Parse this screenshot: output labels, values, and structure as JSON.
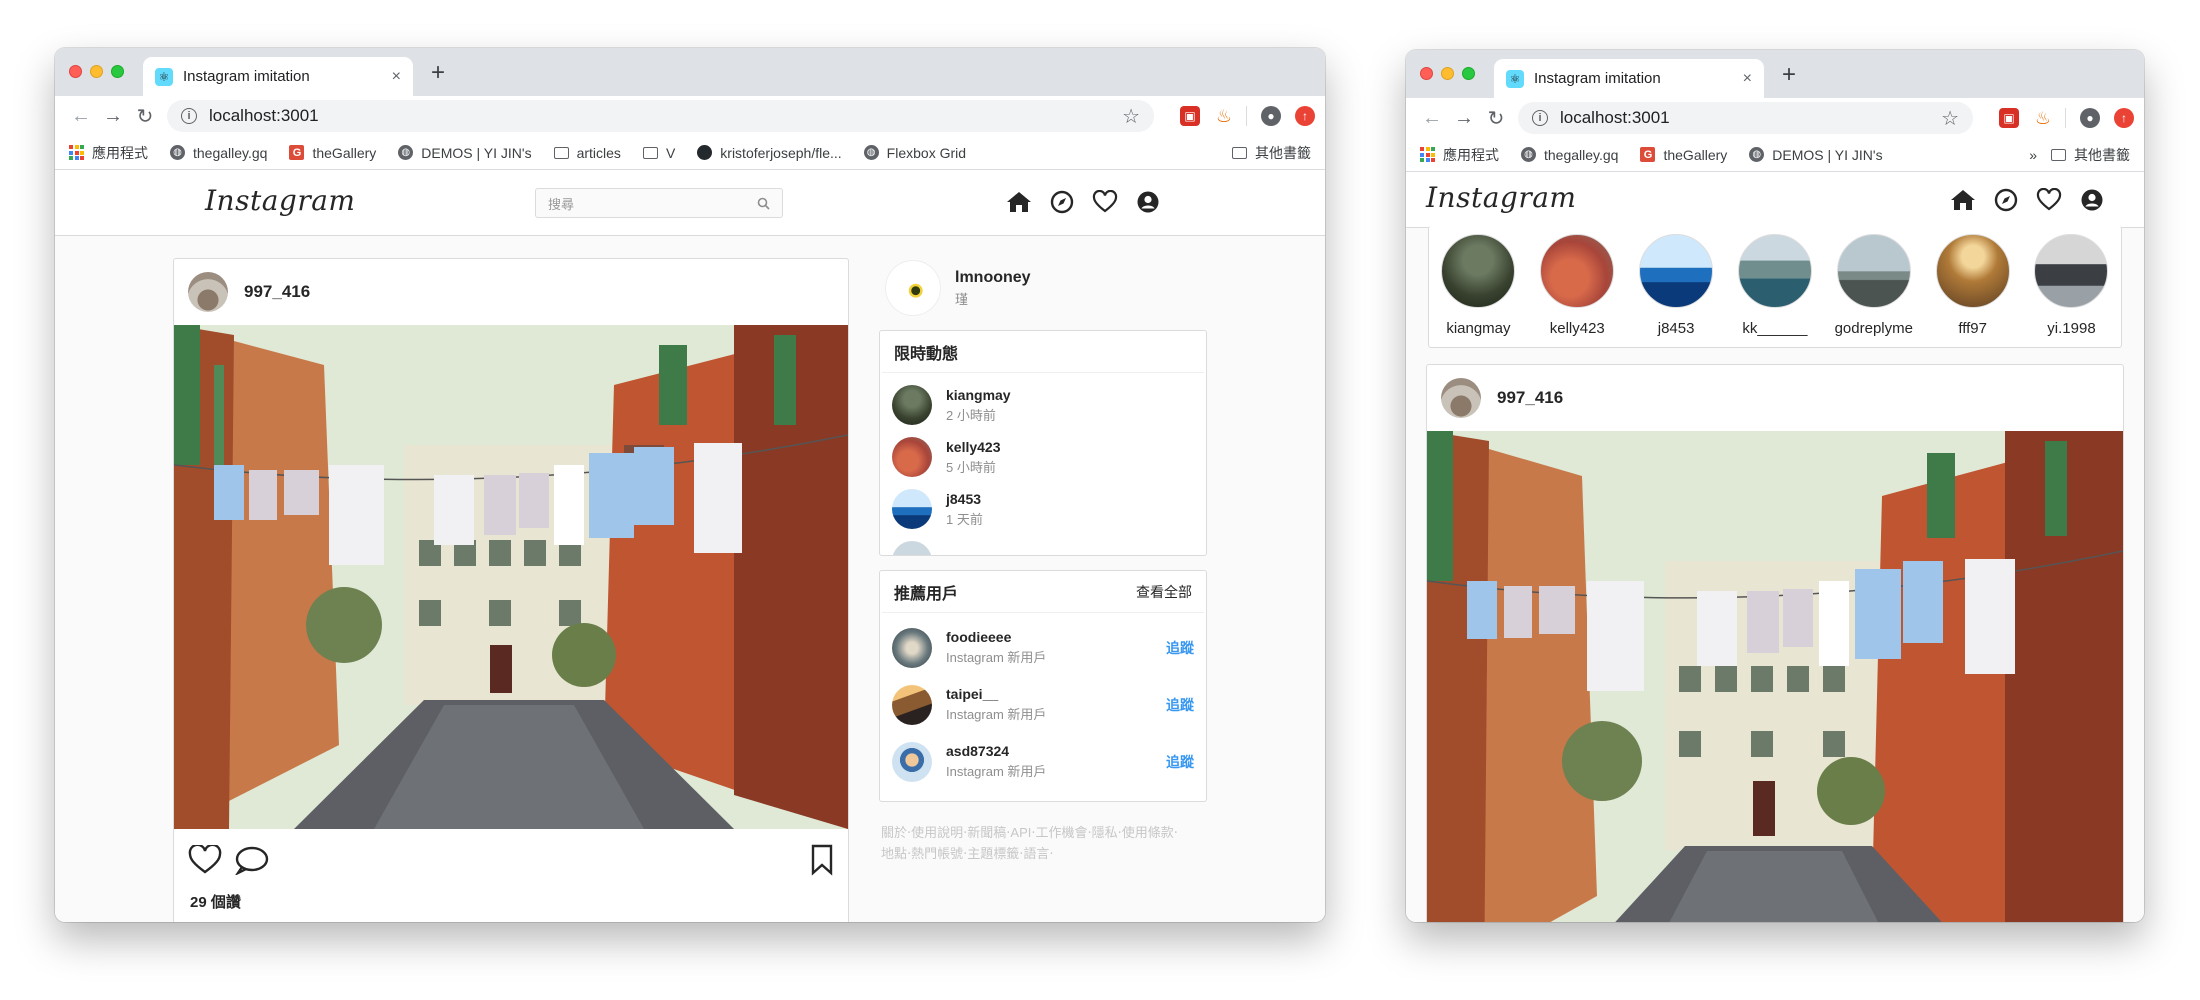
{
  "browser": {
    "tab_title": "Instagram imitation",
    "tab_close": "×",
    "new_tab": "+",
    "url": "localhost:3001",
    "bookmarks": [
      "應用程式",
      "thegalley.gq",
      "theGallery",
      "DEMOS | YI JIN's",
      "articles",
      "V",
      "kristoferjoseph/fle...",
      "Flexbox Grid"
    ],
    "bookmarks_right": "其他書籤",
    "bookmarks_overflow": "»"
  },
  "ig": {
    "logo": "Instagram",
    "search_placeholder": "搜尋",
    "post": {
      "username": "997_416",
      "likes": "29 個讚"
    },
    "profile": {
      "name": "lmnooney",
      "subtitle": "瑾"
    },
    "stories": {
      "title": "限時動態",
      "items": [
        {
          "name": "kiangmay",
          "time": "2 小時前"
        },
        {
          "name": "kelly423",
          "time": "5 小時前"
        },
        {
          "name": "j8453",
          "time": "1 天前"
        },
        {
          "name": "kk"
        }
      ]
    },
    "recommend": {
      "title": "推薦用戶",
      "see_all": "查看全部",
      "follow_label": "追蹤",
      "items": [
        {
          "name": "foodieeee",
          "sub": "Instagram 新用戶"
        },
        {
          "name": "taipei__",
          "sub": "Instagram 新用戶"
        },
        {
          "name": "asd87324",
          "sub": "Instagram 新用戶"
        }
      ]
    },
    "footer": {
      "line1": "關於‧使用說明‧新聞稿‧API‧工作機會‧隱私‧使用條款‧",
      "line2": "地點‧熱門帳號‧主題標籤‧語言‧"
    },
    "story_strip": [
      "kiangmay",
      "kelly423",
      "j8453",
      "kk______",
      "godreplyme",
      "fff97",
      "yi.1998"
    ]
  }
}
